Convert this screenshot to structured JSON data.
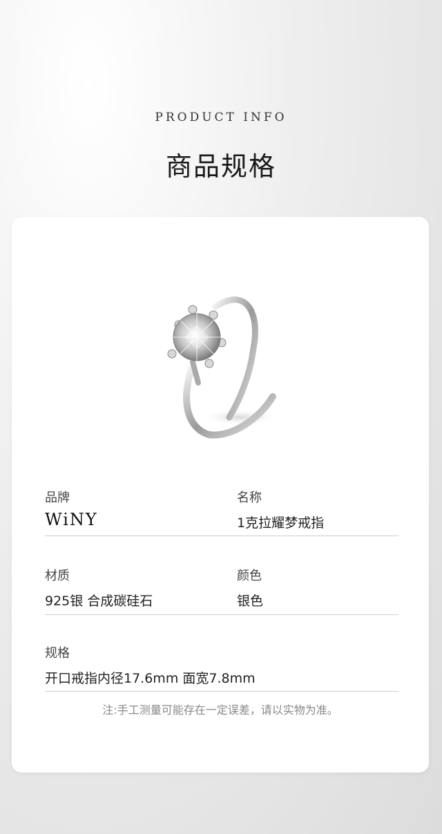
{
  "header": {
    "subtitle_en": "PRODUCT INFO",
    "title_cn": "商品规格"
  },
  "specs": {
    "brand": {
      "label": "品牌",
      "value": "WiNY"
    },
    "name": {
      "label": "名称",
      "value": "1克拉耀梦戒指"
    },
    "material": {
      "label": "材质",
      "value": "925银 合成碳硅石"
    },
    "color": {
      "label": "颜色",
      "value": "银色"
    },
    "size": {
      "label": "规格",
      "value": "开口戒指内径17.6mm 面宽7.8mm"
    }
  },
  "note": "注:手工测量可能存在一定误差，请以实物为准。",
  "icons": {
    "product": "silver-solitaire-ring-image"
  }
}
